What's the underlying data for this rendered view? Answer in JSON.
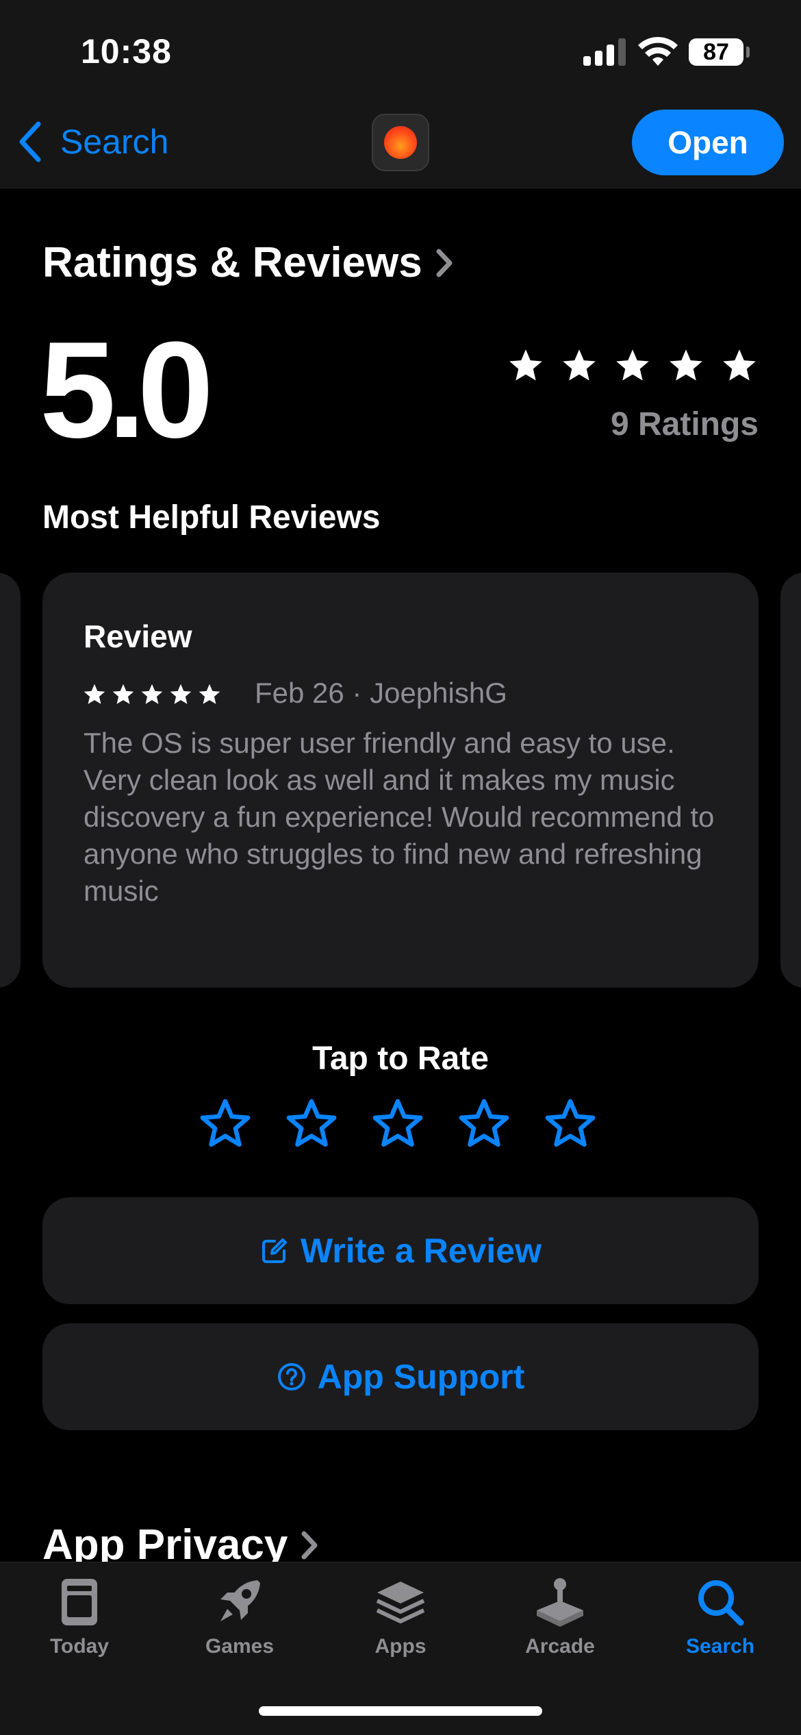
{
  "status_bar": {
    "time": "10:38",
    "battery": "87",
    "signal_bars": 3,
    "signal_bars_total": 4
  },
  "nav": {
    "back_label": "Search",
    "open_label": "Open"
  },
  "ratings": {
    "title": "Ratings & Reviews",
    "score": "5.0",
    "stars": 5,
    "count_label": "9 Ratings",
    "most_helpful_label": "Most Helpful Reviews"
  },
  "review": {
    "title": "Review",
    "stars": 5,
    "meta": "Feb 26 · JoephishG",
    "body": "The OS is super user friendly and easy to use. Very clean look as well and it makes my music discovery a fun experience! Would recommend to anyone who struggles to find new and refreshing music"
  },
  "tap_to_rate": {
    "label": "Tap to Rate",
    "stars": 5
  },
  "actions": {
    "write_review": "Write a Review",
    "app_support": "App Support"
  },
  "app_privacy": {
    "title": "App Privacy"
  },
  "tabs": [
    {
      "label": "Today",
      "icon": "today-icon"
    },
    {
      "label": "Games",
      "icon": "rocket-icon"
    },
    {
      "label": "Apps",
      "icon": "apps-stack-icon"
    },
    {
      "label": "Arcade",
      "icon": "joystick-icon"
    },
    {
      "label": "Search",
      "icon": "search-icon",
      "active": true
    }
  ],
  "colors": {
    "accent": "#0a84ff",
    "card": "#1c1c1e",
    "secondary_text": "#8e8e93"
  }
}
